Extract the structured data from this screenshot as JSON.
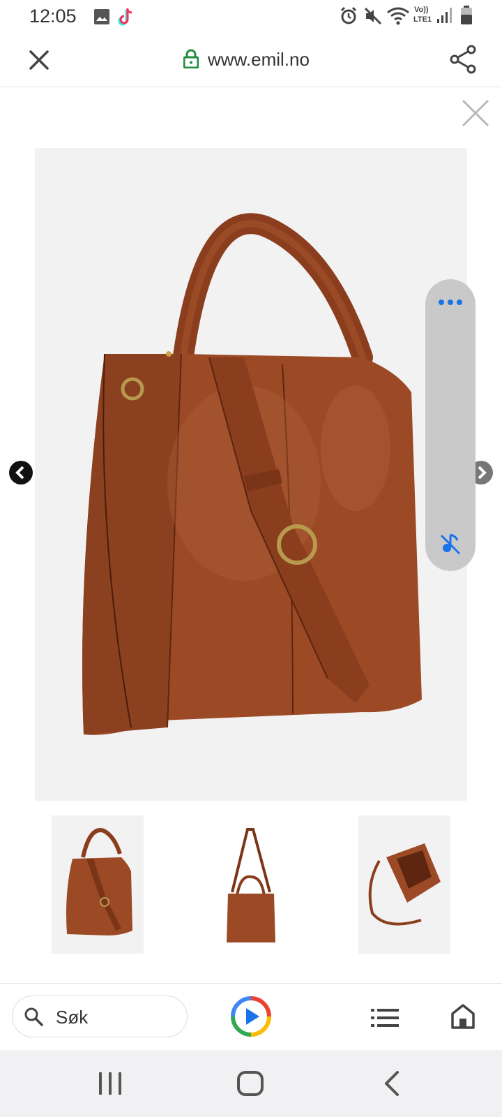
{
  "status_bar": {
    "time": "12:05",
    "carrier_label_top": "Vo))",
    "carrier_label_bottom": "LTE1",
    "icons": [
      "gallery-icon",
      "tiktok-icon",
      "alarm-icon",
      "mute-icon",
      "wifi-icon",
      "signal-icon",
      "battery-icon"
    ]
  },
  "browser": {
    "url": "www.emil.no",
    "icons": [
      "close-icon",
      "lock-icon",
      "share-icon"
    ]
  },
  "viewer": {
    "thumbnails_count": 3,
    "icons": [
      "close-viewer-icon",
      "prev-arrow-icon",
      "next-arrow-icon",
      "more-icon",
      "music-off-icon"
    ]
  },
  "bottom_bar": {
    "search_label": "Søk",
    "icons": [
      "search-icon",
      "play-icon",
      "list-icon",
      "home-icon"
    ]
  },
  "nav_bar": {
    "icons": [
      "recents-icon",
      "home-nav-icon",
      "back-icon"
    ]
  },
  "colors": {
    "accent_blue": "#1a73e8",
    "lock_green": "#1e8e3e",
    "leather": "#9c4a26"
  }
}
